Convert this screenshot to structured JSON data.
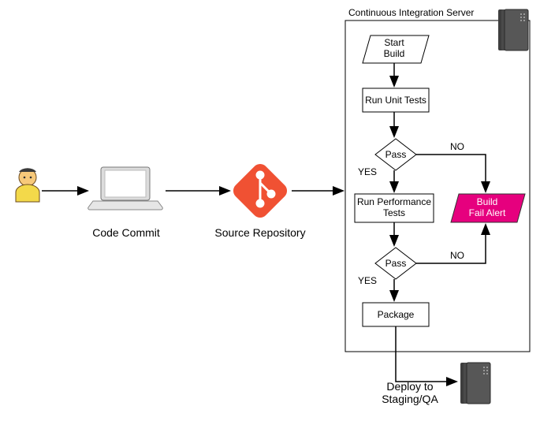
{
  "title": "Continuous Integration Server",
  "labels": {
    "code_commit": "Code Commit",
    "source_repo": "Source Repository",
    "deploy": "Deploy to",
    "deploy2": "Staging/QA"
  },
  "nodes": {
    "start": "Start",
    "start2": "Build",
    "unit": "Run Unit Tests",
    "pass1": "Pass",
    "perf1": "Run Performance",
    "perf2": "Tests",
    "pass2": "Pass",
    "package": "Package",
    "alert1": "Build",
    "alert2": "Fail Alert"
  },
  "edges": {
    "yes": "YES",
    "no": "NO"
  }
}
